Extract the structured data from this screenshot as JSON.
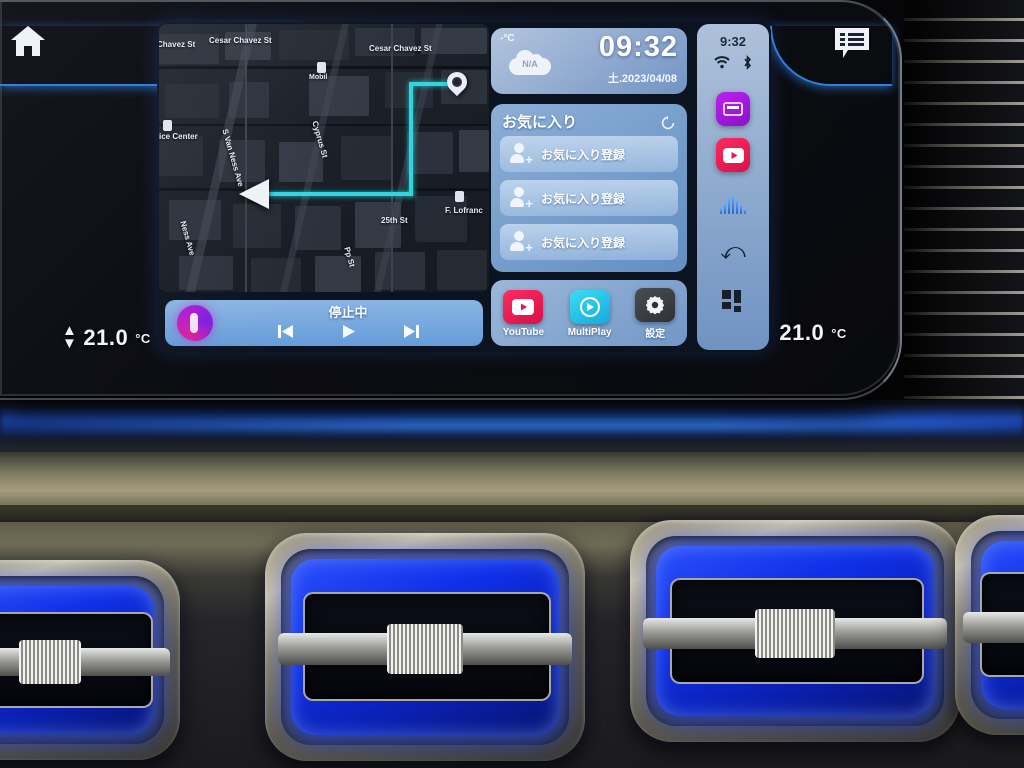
{
  "vehicle_ui": {
    "top_left_icon": "home-icon",
    "top_right_icon": "message-list-icon",
    "climate": {
      "left_temp": "21.0",
      "left_unit": "°C",
      "right_temp": "21.0",
      "right_unit": "°C",
      "stepper_glyph": "↕"
    }
  },
  "map": {
    "labels": [
      {
        "text": "Chavez St"
      },
      {
        "text": "Cesar Chavez St"
      },
      {
        "text": "Cesar Chavez St"
      },
      {
        "text": "Mobil"
      },
      {
        "text": "ice Center"
      },
      {
        "text": "S Van Ness Ave"
      },
      {
        "text": "Cyprus St"
      },
      {
        "text": "Ness Ave"
      },
      {
        "text": "F. Lofranc"
      },
      {
        "text": "25th St"
      },
      {
        "text": "Pp St"
      }
    ],
    "route_color": "#2fd6e0",
    "destination_marker": "map-pin-icon",
    "vehicle_marker": "navigation-arrow-icon"
  },
  "media": {
    "status": "停止中",
    "prev_label": "prev-track",
    "play_label": "play",
    "next_label": "next-track",
    "source_icon": "music-orb-icon"
  },
  "clock_widget": {
    "temp_unit_label": "-°C",
    "weather_value": "N/A",
    "weather_icon": "cloud-icon",
    "time": "09:32",
    "date": "土.2023/04/08"
  },
  "favorites": {
    "title": "お気に入り",
    "refresh_icon": "refresh-icon",
    "rows": [
      {
        "label": "お気に入り登録"
      },
      {
        "label": "お気に入り登録"
      },
      {
        "label": "お気に入り登録"
      }
    ]
  },
  "apps": [
    {
      "name": "YouTube",
      "icon": "youtube-icon",
      "color": "#e8174e"
    },
    {
      "name": "MultiPlay",
      "icon": "multiplay-icon",
      "color": "#1fc8e8"
    },
    {
      "name": "設定",
      "icon": "gear-icon",
      "color": "#3c3f44"
    }
  ],
  "sidebar": {
    "time": "9:32",
    "wifi_icon": "wifi-icon",
    "bluetooth_icon": "bluetooth-icon",
    "items": [
      {
        "name": "hdmi-app-icon",
        "color": "#a31ae0"
      },
      {
        "name": "youtube-app-icon",
        "color": "#e8174e"
      },
      {
        "name": "voice-waveform-icon",
        "color": "#3b82f6"
      },
      {
        "name": "back-arrow-icon",
        "glyph": "↩"
      },
      {
        "name": "app-grid-icon",
        "color": "#16202c"
      }
    ]
  }
}
